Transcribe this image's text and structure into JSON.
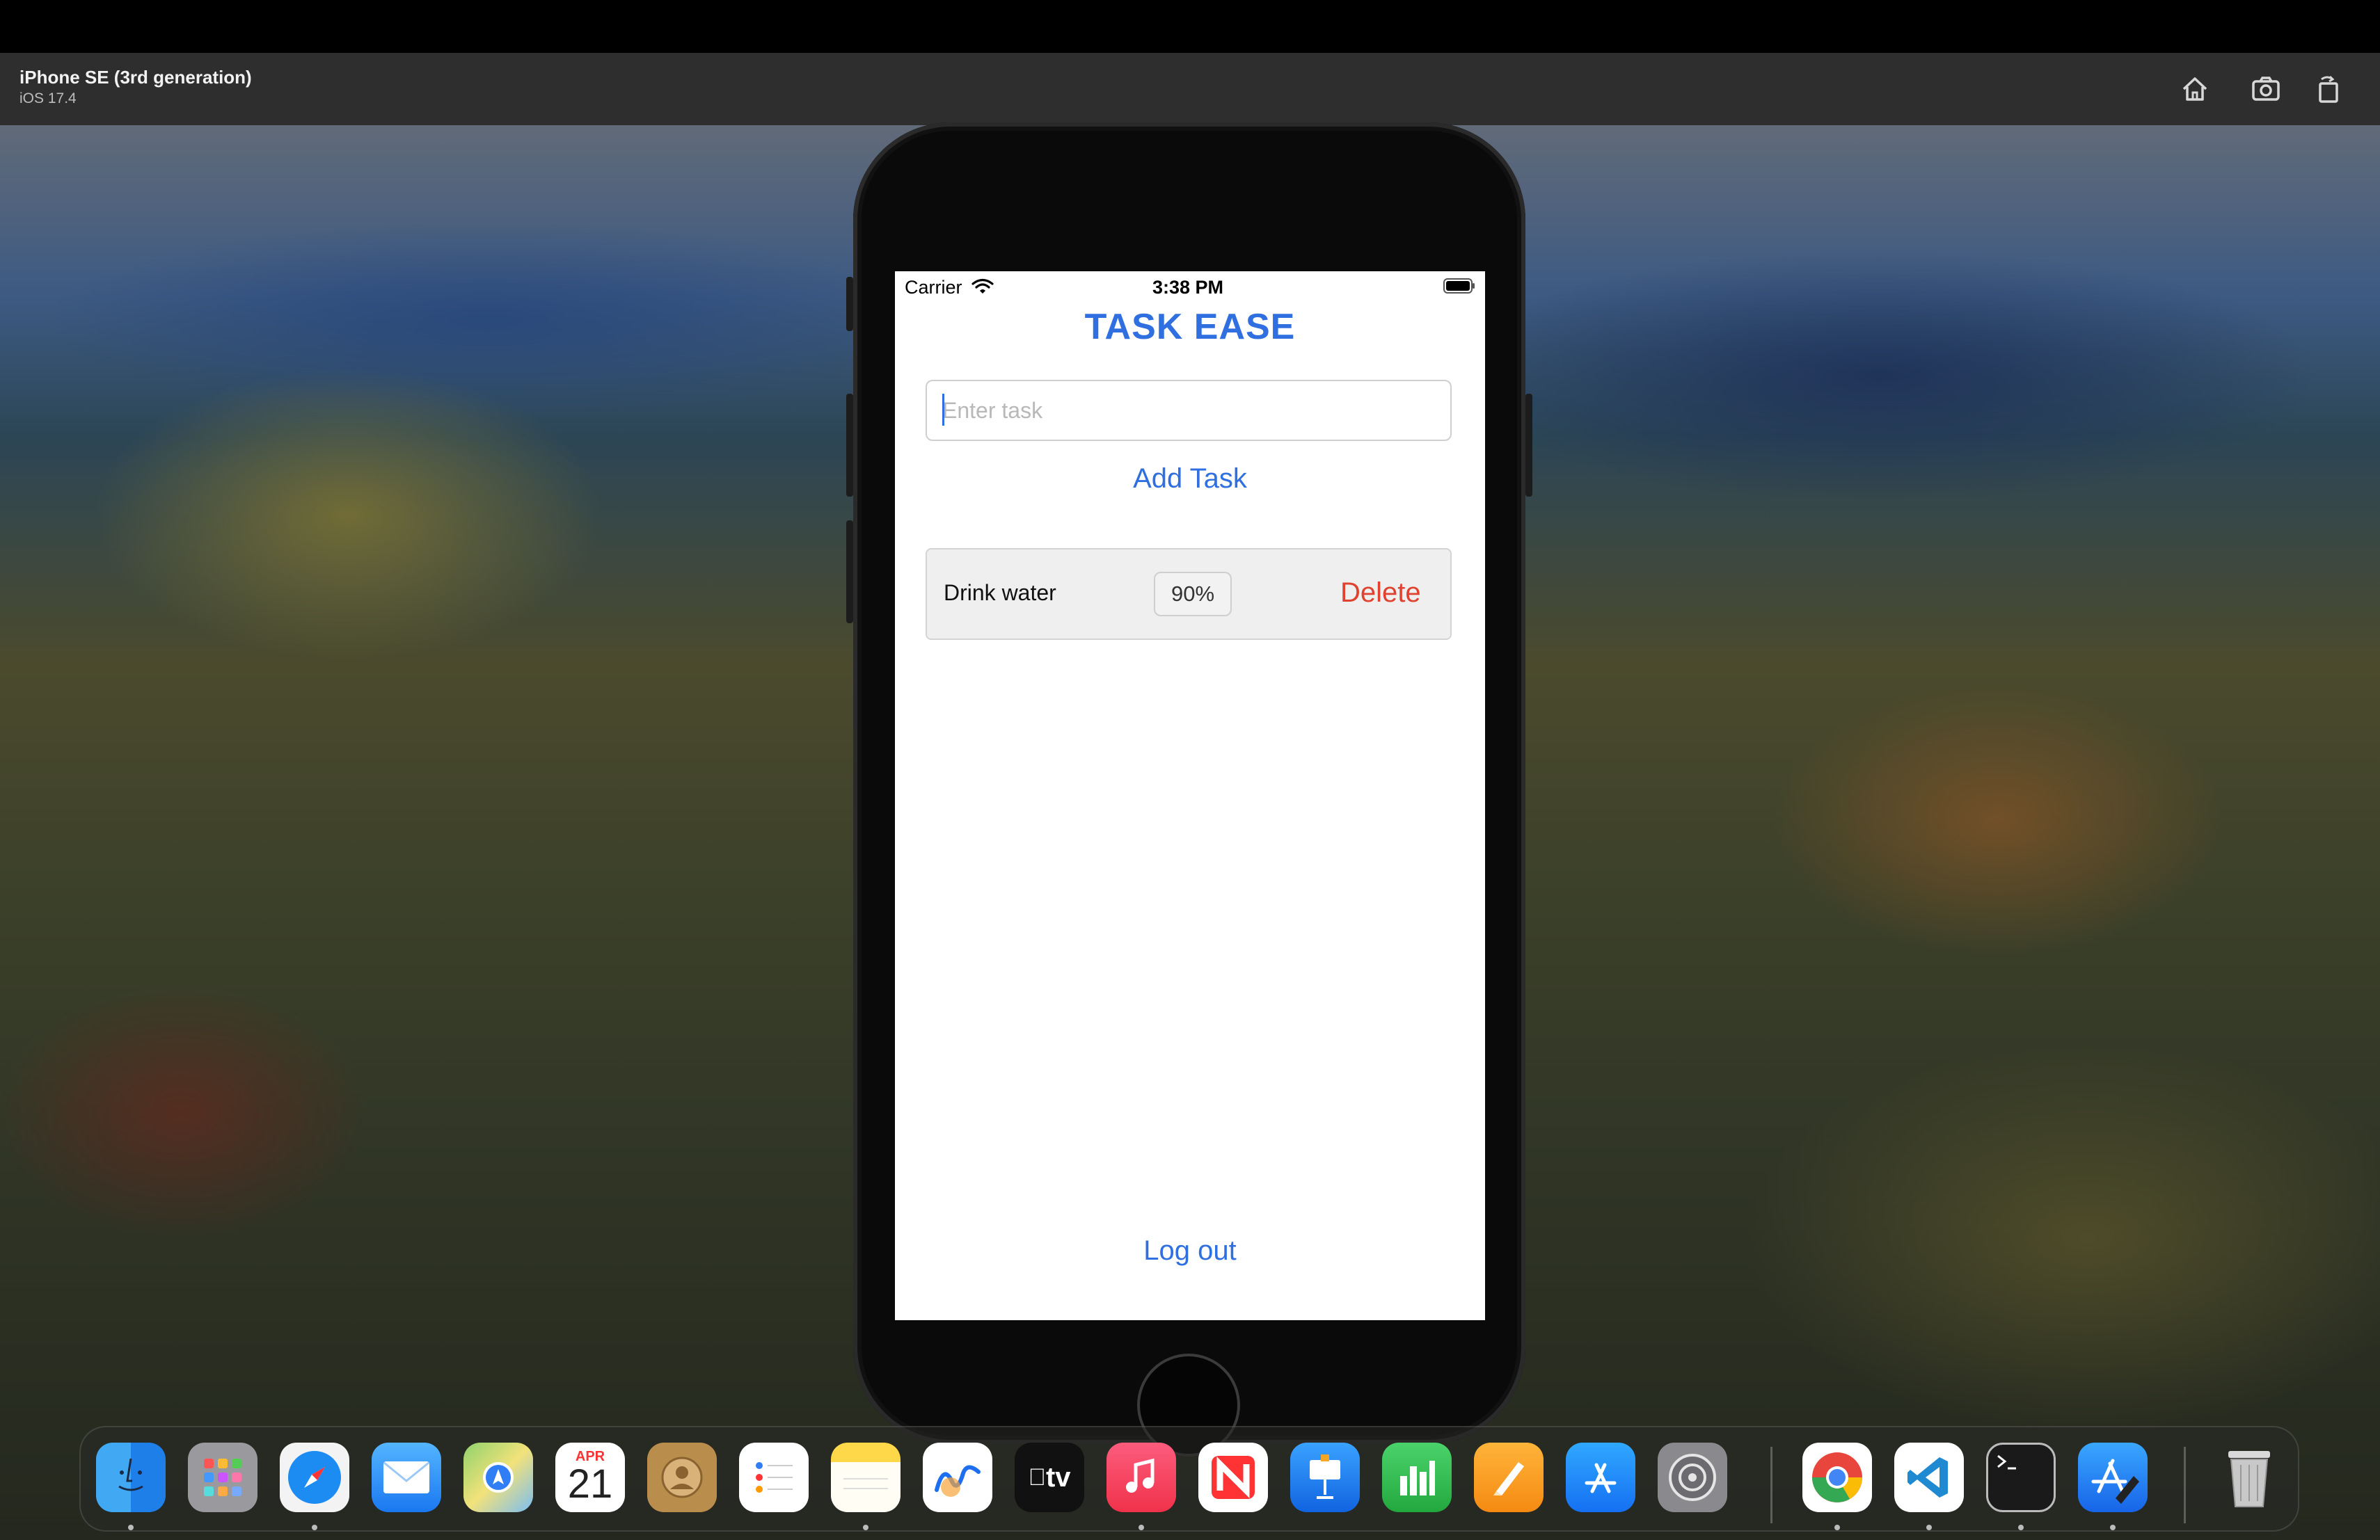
{
  "simulator": {
    "device_name": "iPhone SE (3rd generation)",
    "os_version": "iOS 17.4",
    "toolbar_icons": [
      "home-icon",
      "screenshot-icon",
      "rotate-icon"
    ]
  },
  "status_bar": {
    "carrier": "Carrier",
    "time": "3:38 PM"
  },
  "app": {
    "title": "TASK EASE",
    "task_input_placeholder": "Enter task",
    "add_task_label": "Add Task",
    "tasks": [
      {
        "name": "Drink water",
        "progress": "90%",
        "delete_label": "Delete"
      }
    ],
    "logout_label": "Log out",
    "accent_color": "#2f6fe0",
    "delete_color": "#e0422f"
  },
  "dock": {
    "calendar_month": "APR",
    "calendar_day": "21",
    "tv_label": "tv"
  }
}
